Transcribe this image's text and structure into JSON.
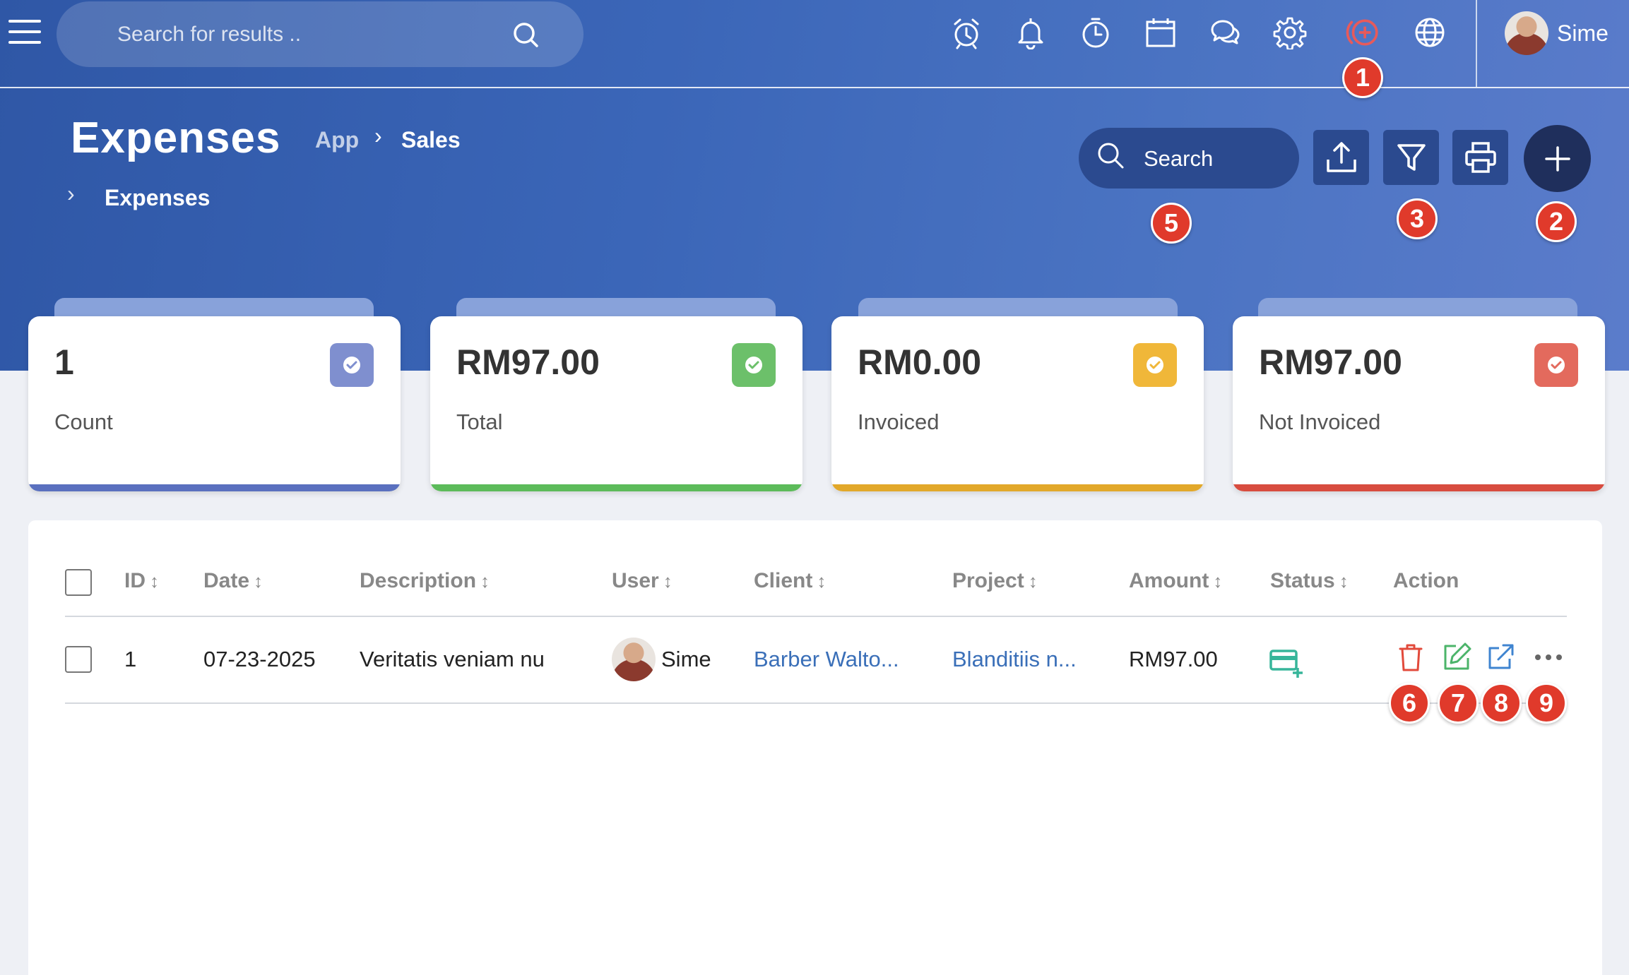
{
  "topbar": {
    "search_placeholder": "Search for results ..",
    "user_name": "Sime",
    "icons": [
      "alarm-icon",
      "bell-icon",
      "timer-icon",
      "calendar-icon",
      "chat-icon",
      "gear-icon",
      "add-circle-icon",
      "globe-icon"
    ]
  },
  "header": {
    "title": "Expenses",
    "breadcrumb": [
      "App",
      "Sales",
      "Expenses"
    ],
    "search_placeholder": "Search"
  },
  "badges": [
    "1",
    "2",
    "3",
    "5",
    "6",
    "7",
    "8",
    "9"
  ],
  "cards": [
    {
      "value": "1",
      "label": "Count",
      "color": "#7f8fcf",
      "bar": "#5a70bf"
    },
    {
      "value": "RM97.00",
      "label": "Total",
      "color": "#6cc06a",
      "bar": "#5cbb5a"
    },
    {
      "value": "RM0.00",
      "label": "Invoiced",
      "color": "#f0b739",
      "bar": "#e2a82a"
    },
    {
      "value": "RM97.00",
      "label": "Not Invoiced",
      "color": "#e36a5d",
      "bar": "#d84c3f"
    }
  ],
  "table": {
    "columns": [
      "ID",
      "Date",
      "Description",
      "User",
      "Client",
      "Project",
      "Amount",
      "Status",
      "Action"
    ],
    "sort_glyph": "↕",
    "rows": [
      {
        "id": "1",
        "date": "07-23-2025",
        "description": "Veritatis veniam nu",
        "user": "Sime",
        "client": "Barber Walto...",
        "project": "Blanditiis n...",
        "amount": "RM97.00"
      }
    ]
  },
  "colors": {
    "delete": "#e24a3b",
    "edit": "#4cb46a",
    "open": "#3f84d0",
    "status": "#37b59a"
  }
}
